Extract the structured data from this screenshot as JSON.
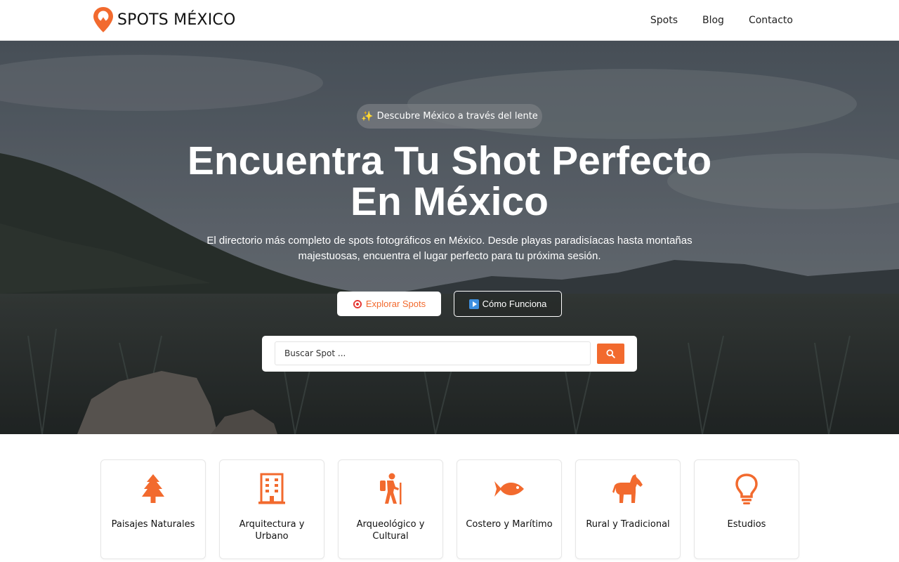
{
  "brand": {
    "name": "SPOTS MÉXICO",
    "accent": "#f26a2e",
    "icon": "map-pin-logo-icon"
  },
  "nav": {
    "items": [
      {
        "label": "Spots"
      },
      {
        "label": "Blog"
      },
      {
        "label": "Contacto"
      }
    ]
  },
  "hero": {
    "badge": "Descubre México a través del lente",
    "badge_icon": "sparkles-icon",
    "title_line1": "Encuentra Tu Shot Perfecto",
    "title_line2": "En México",
    "subtitle": "El directorio más completo de spots fotográficos en México. Desde playas paradisíacas hasta montañas majestuosas, encuentra el lugar perfecto para tu próxima sesión.",
    "primary_button": "Explorar Spots",
    "primary_button_icon": "target-icon",
    "secondary_button": "Cómo Funciona",
    "secondary_button_icon": "play-icon"
  },
  "search": {
    "placeholder": "Buscar Spot ...",
    "button_icon": "search-icon"
  },
  "categories": [
    {
      "label": "Paisajes Naturales",
      "icon": "tree-icon"
    },
    {
      "label": "Arquitectura y Urbano",
      "icon": "building-icon"
    },
    {
      "label": "Arqueológico y Cultural",
      "icon": "hiker-icon"
    },
    {
      "label": "Costero y Marítimo",
      "icon": "fish-icon"
    },
    {
      "label": "Rural y Tradicional",
      "icon": "horse-icon"
    },
    {
      "label": "Estudios",
      "icon": "lightbulb-icon"
    }
  ]
}
